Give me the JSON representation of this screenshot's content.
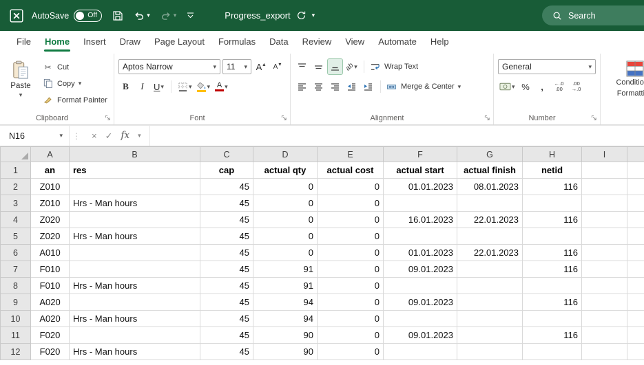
{
  "colors": {
    "titlebar_green": "#185C37",
    "accent_green": "#0F7B41",
    "search_pill_green": "#3E7D5E"
  },
  "title_bar": {
    "autosave_label": "AutoSave",
    "autosave_state": "Off",
    "document_title": "Progress_export",
    "search_label": "Search"
  },
  "menu_tabs": [
    {
      "label": "File",
      "active": false
    },
    {
      "label": "Home",
      "active": true
    },
    {
      "label": "Insert",
      "active": false
    },
    {
      "label": "Draw",
      "active": false
    },
    {
      "label": "Page Layout",
      "active": false
    },
    {
      "label": "Formulas",
      "active": false
    },
    {
      "label": "Data",
      "active": false
    },
    {
      "label": "Review",
      "active": false
    },
    {
      "label": "View",
      "active": false
    },
    {
      "label": "Automate",
      "active": false
    },
    {
      "label": "Help",
      "active": false
    }
  ],
  "ribbon": {
    "clipboard": {
      "group_label": "Clipboard",
      "paste_label": "Paste",
      "cut_label": "Cut",
      "copy_label": "Copy",
      "format_painter_label": "Format Painter"
    },
    "font": {
      "group_label": "Font",
      "font_name": "Aptos Narrow",
      "font_size": "11",
      "bold": "B",
      "italic": "I",
      "underline": "U",
      "grow_letter": "A",
      "shrink_letter": "A"
    },
    "alignment": {
      "group_label": "Alignment",
      "wrap_text_label": "Wrap Text",
      "merge_center_label": "Merge & Center",
      "orientation_glyph": "ab"
    },
    "number": {
      "group_label": "Number",
      "format_selected": "General",
      "percent": "%",
      "comma": ",",
      "increase_decimal_glyph": "←.0 .00",
      "decrease_decimal_glyph": ".00 →.0"
    },
    "styles": {
      "conditional_formatting_line1": "Conditional",
      "conditional_formatting_line2": "Formatting"
    }
  },
  "formula_bar": {
    "name_box_value": "N16",
    "fx_label": "fx",
    "formula_value": "",
    "cancel_glyph": "×",
    "enter_glyph": "✓",
    "grip_glyph": "⋮"
  },
  "icons": {
    "dropdown": "▾",
    "up_caret": "▴",
    "scissors": "✂"
  },
  "sheet": {
    "column_headers": [
      "A",
      "B",
      "C",
      "D",
      "E",
      "F",
      "G",
      "H",
      "I"
    ],
    "rows": [
      {
        "row_num": "1",
        "bold": true,
        "cells": [
          "an",
          "res",
          "cap",
          "actual qty",
          "actual cost",
          "actual start",
          "actual finish",
          "netid",
          ""
        ]
      },
      {
        "row_num": "2",
        "bold": false,
        "cells": [
          "Z010",
          "",
          "45",
          "0",
          "0",
          "01.01.2023",
          "08.01.2023",
          "116",
          ""
        ]
      },
      {
        "row_num": "3",
        "bold": false,
        "cells": [
          "Z010",
          "Hrs - Man hours",
          "45",
          "0",
          "0",
          "",
          "",
          "",
          ""
        ]
      },
      {
        "row_num": "4",
        "bold": false,
        "cells": [
          "Z020",
          "",
          "45",
          "0",
          "0",
          "16.01.2023",
          "22.01.2023",
          "116",
          ""
        ]
      },
      {
        "row_num": "5",
        "bold": false,
        "cells": [
          "Z020",
          "Hrs - Man hours",
          "45",
          "0",
          "0",
          "",
          "",
          "",
          ""
        ]
      },
      {
        "row_num": "6",
        "bold": false,
        "cells": [
          "A010",
          "",
          "45",
          "0",
          "0",
          "01.01.2023",
          "22.01.2023",
          "116",
          ""
        ]
      },
      {
        "row_num": "7",
        "bold": false,
        "cells": [
          "F010",
          "",
          "45",
          "91",
          "0",
          "09.01.2023",
          "",
          "116",
          ""
        ]
      },
      {
        "row_num": "8",
        "bold": false,
        "cells": [
          "F010",
          "Hrs - Man hours",
          "45",
          "91",
          "0",
          "",
          "",
          "",
          ""
        ]
      },
      {
        "row_num": "9",
        "bold": false,
        "cells": [
          "A020",
          "",
          "45",
          "94",
          "0",
          "09.01.2023",
          "",
          "116",
          ""
        ]
      },
      {
        "row_num": "10",
        "bold": false,
        "cells": [
          "A020",
          "Hrs - Man hours",
          "45",
          "94",
          "0",
          "",
          "",
          "",
          ""
        ]
      },
      {
        "row_num": "11",
        "bold": false,
        "cells": [
          "F020",
          "",
          "45",
          "90",
          "0",
          "09.01.2023",
          "",
          "116",
          ""
        ]
      },
      {
        "row_num": "12",
        "bold": false,
        "cells": [
          "F020",
          "Hrs - Man hours",
          "45",
          "90",
          "0",
          "",
          "",
          "",
          ""
        ]
      }
    ]
  }
}
